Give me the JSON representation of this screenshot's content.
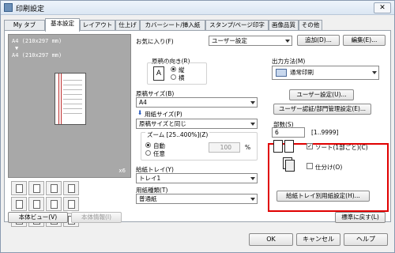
{
  "window": {
    "title": "印刷設定",
    "close_glyph": "✕"
  },
  "tabs": [
    {
      "label": "My タブ"
    },
    {
      "label": "基本設定"
    },
    {
      "label": "レイアウト"
    },
    {
      "label": "仕上げ"
    },
    {
      "label": "カバーシート/挿入紙"
    },
    {
      "label": "スタンプ/ページ印字"
    },
    {
      "label": "画像品質"
    },
    {
      "label": "その他"
    }
  ],
  "preview": {
    "line1": "A4 (210x297 mm)",
    "arrow": "▼",
    "line2": "A4 (210x297 mm)",
    "copies_badge": "x6",
    "view_button": "本体ビュー(V)",
    "info_button": "本体情報(I)"
  },
  "favorites": {
    "label": "お気に入り(F)",
    "value": "ユーザー設定",
    "add_button": "追加(D)...",
    "edit_button": "編集(E)..."
  },
  "orientation": {
    "label": "原稿の向き(R)",
    "opt1": "縦",
    "opt2": "横"
  },
  "original_size": {
    "label": "原稿サイズ(B)",
    "value": "A4"
  },
  "paper_size": {
    "label": "用紙サイズ(P)",
    "value": "原稿サイズと同じ"
  },
  "zoom": {
    "label": "ズーム [25..400%](Z)",
    "auto": "自動",
    "manual": "任意",
    "value": "100",
    "unit": "%"
  },
  "tray": {
    "label": "給紙トレイ(Y)",
    "value": "トレイ1"
  },
  "paper_type": {
    "label": "用紙種類(T)",
    "value": "普通紙"
  },
  "output": {
    "label": "出力方法(M)",
    "value": "通常印刷",
    "user_settings_button": "ユーザー設定(U)...",
    "auth_button": "ユーザー認証/部門管理設定(E)..."
  },
  "copies": {
    "label": "部数(S)",
    "value": "6",
    "range": "[1..9999]",
    "collate_label": "ソート(1部ごと)(C)",
    "offset_label": "仕分け(O)",
    "check": "✓"
  },
  "tray_paper_button": "給紙トレイ別用紙設定(H)...",
  "defaults_button": "標準に戻す(L)",
  "buttons": {
    "ok": "OK",
    "cancel": "キャンセル",
    "help": "ヘルプ"
  }
}
